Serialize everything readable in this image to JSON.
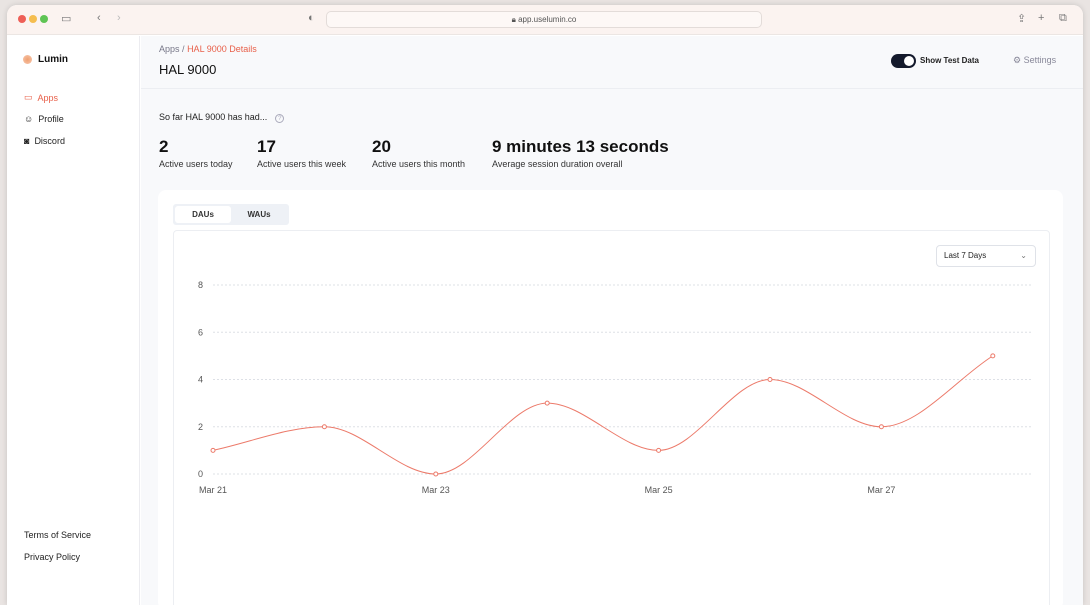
{
  "browser": {
    "url": "app.uselumin.co"
  },
  "sidebar": {
    "brand": "Lumin",
    "items": [
      {
        "label": "Apps",
        "icon": "monitor-icon",
        "active": true
      },
      {
        "label": "Profile",
        "icon": "user-icon"
      },
      {
        "label": "Discord",
        "icon": "discord-icon"
      }
    ],
    "footer": [
      "Terms of Service",
      "Privacy Policy"
    ]
  },
  "header": {
    "breadcrumb_root": "Apps",
    "breadcrumb_sep": "/",
    "breadcrumb_current": "HAL 9000 Details",
    "title": "HAL 9000",
    "toggle_label": "Show Test Data",
    "toggle_on": true,
    "settings": "Settings"
  },
  "summary": {
    "intro": "So far HAL 9000 has had...",
    "stats": [
      {
        "value": "2",
        "label": "Active users today"
      },
      {
        "value": "17",
        "label": "Active users this week"
      },
      {
        "value": "20",
        "label": "Active users this month"
      },
      {
        "value": "9 minutes 13 seconds",
        "label": "Average session duration overall"
      }
    ]
  },
  "tabs": [
    {
      "label": "DAUs",
      "active": true
    },
    {
      "label": "WAUs"
    }
  ],
  "range": "Last 7 Days",
  "colors": {
    "accent": "#e8604a",
    "line": "#ec7a6a"
  },
  "chart_data": {
    "type": "line",
    "x": [
      "Mar 21",
      "Mar 22",
      "Mar 23",
      "Mar 24",
      "Mar 25",
      "Mar 26",
      "Mar 27",
      "Mar 28"
    ],
    "values": [
      1,
      2,
      0,
      3,
      1,
      4,
      2,
      5
    ],
    "xticks": [
      "Mar 21",
      "Mar 23",
      "Mar 25",
      "Mar 27"
    ],
    "yticks": [
      0,
      2,
      4,
      6,
      8
    ],
    "ylim": [
      0,
      8
    ],
    "grid": true,
    "curve": "smooth"
  }
}
